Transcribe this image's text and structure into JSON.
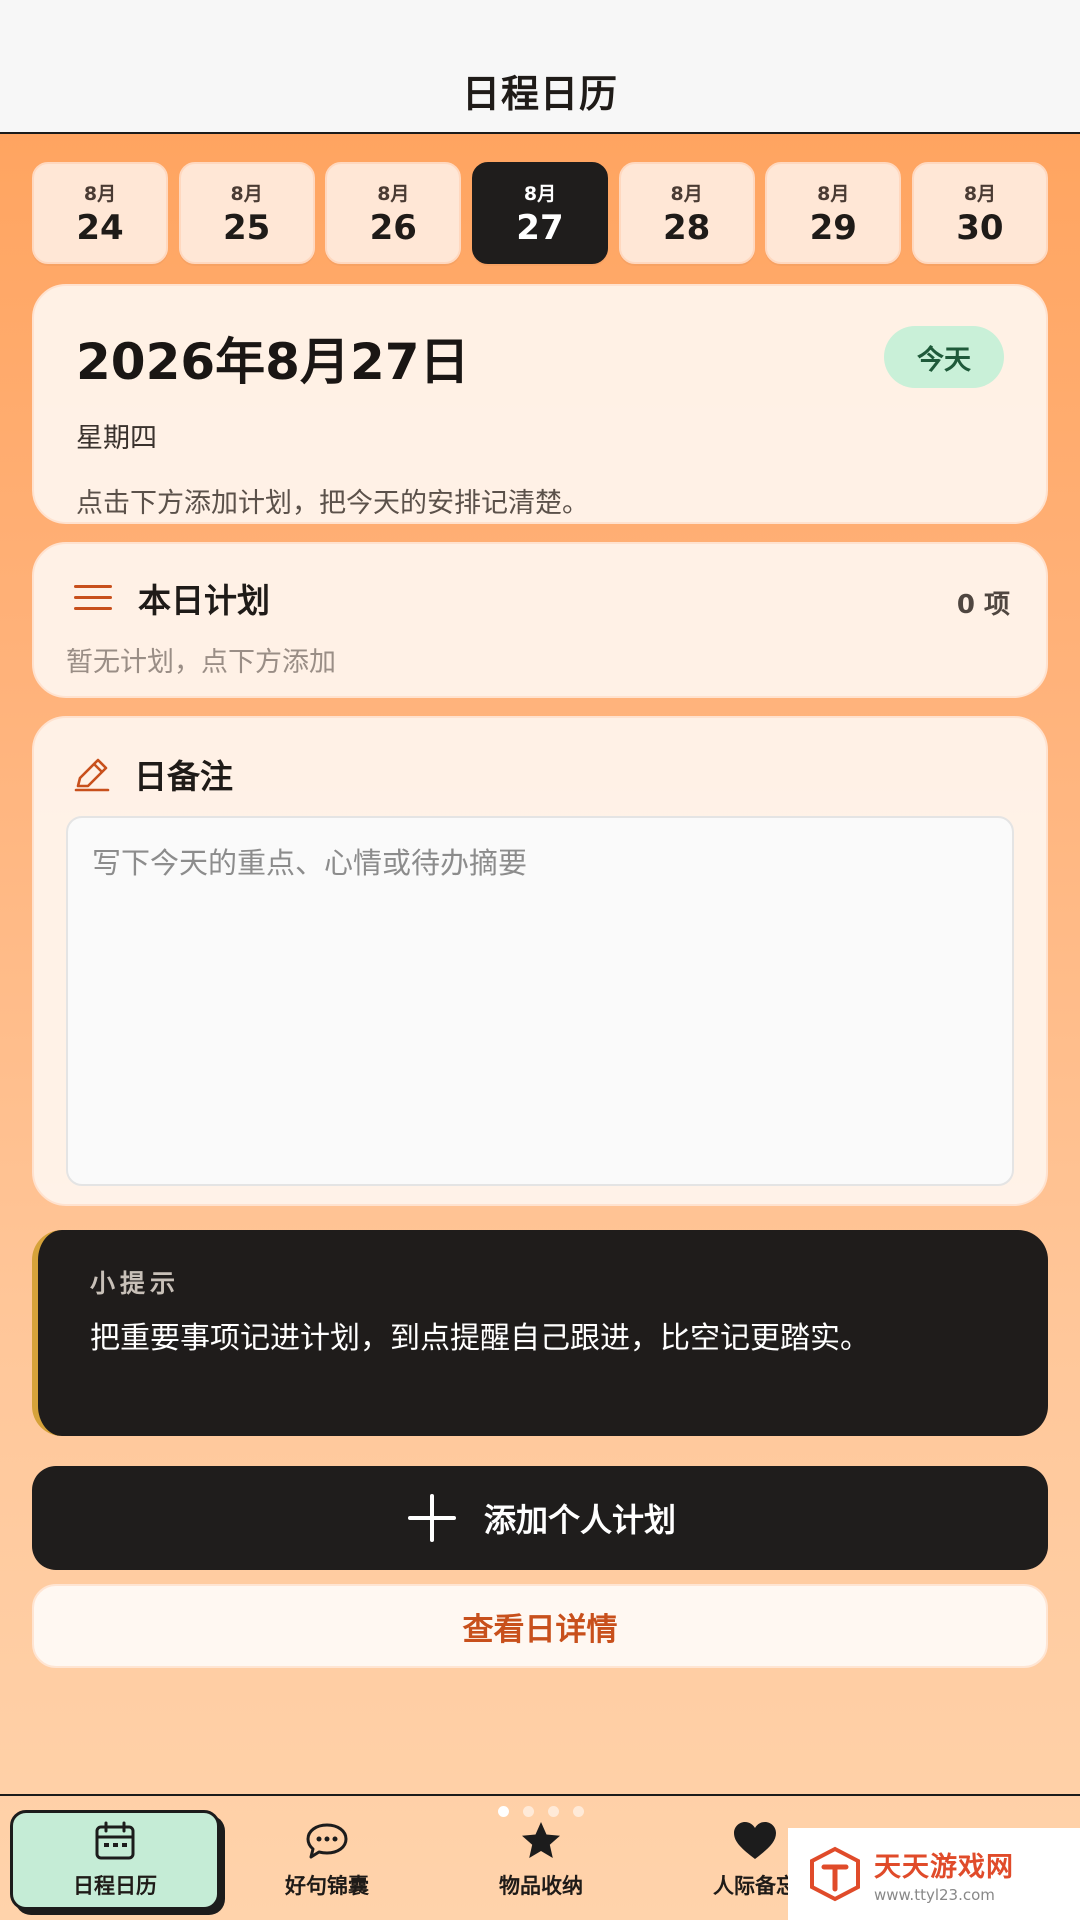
{
  "header": {
    "title": "日程日历"
  },
  "date_strip": [
    {
      "month": "8月",
      "day": "24",
      "active": false
    },
    {
      "month": "8月",
      "day": "25",
      "active": false
    },
    {
      "month": "8月",
      "day": "26",
      "active": false
    },
    {
      "month": "8月",
      "day": "27",
      "active": true
    },
    {
      "month": "8月",
      "day": "28",
      "active": false
    },
    {
      "month": "8月",
      "day": "29",
      "active": false
    },
    {
      "month": "8月",
      "day": "30",
      "active": false
    }
  ],
  "date_card": {
    "date": "2026年8月27日",
    "weekday": "星期四",
    "hint": "点击下方添加计划，把今天的安排记清楚。",
    "today_badge": "今天"
  },
  "plan_card": {
    "title": "本日计划",
    "count": "0 项",
    "empty_text": "暂无计划，点下方添加"
  },
  "note_card": {
    "title": "日备注",
    "placeholder": "写下今天的重点、心情或待办摘要"
  },
  "tip_card": {
    "label": "小提示",
    "text": "把重要事项记进计划，到点提醒自己跟进，比空记更踏实。"
  },
  "actions": {
    "add_plan": "添加个人计划",
    "view_detail": "查看日详情"
  },
  "bottom_nav": {
    "items": [
      {
        "label": "日程日历",
        "icon": "calendar-icon",
        "active": true
      },
      {
        "label": "好句锦囊",
        "icon": "chat-bubble-icon",
        "active": false
      },
      {
        "label": "物品收纳",
        "icon": "star-icon",
        "active": false
      },
      {
        "label": "人际备忘",
        "icon": "heart-icon",
        "active": false
      }
    ],
    "page_dots": 4,
    "active_dot": 0
  },
  "watermark": {
    "name": "天天游戏网",
    "url": "www.ttyl23.com"
  },
  "colors": {
    "accent": "#c8501c",
    "dark": "#1f1d1c",
    "badge_green": "#c9f0d8",
    "nav_active": "#c5ecd6"
  }
}
